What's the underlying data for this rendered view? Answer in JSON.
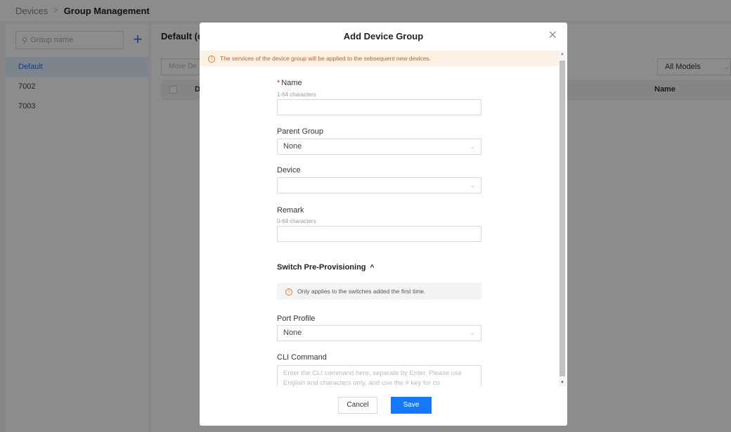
{
  "breadcrumb": {
    "parent": "Devices",
    "current": "Group Management"
  },
  "sidebar": {
    "search_placeholder": "Group name",
    "groups": [
      {
        "label": "Default",
        "active": true
      },
      {
        "label": "7002",
        "active": false
      },
      {
        "label": "7003",
        "active": false
      }
    ]
  },
  "main": {
    "title": "Default (d",
    "move_button": "Move De",
    "models_select": "All Models",
    "table_columns": {
      "checkbox": "",
      "first": "D",
      "name": "Name"
    }
  },
  "modal": {
    "title": "Add Device Group",
    "notice": "The services of the device group will be applied to the sebsequent new devices.",
    "fields": {
      "name": {
        "label": "Name",
        "required_mark": "*",
        "hint": "1-64 characters",
        "value": ""
      },
      "parent_group": {
        "label": "Parent Group",
        "value": "None"
      },
      "device": {
        "label": "Device",
        "value": ""
      },
      "remark": {
        "label": "Remark",
        "hint": "0-64 characters",
        "value": ""
      }
    },
    "section": {
      "title": "Switch Pre-Provisioning",
      "info": "Only applies to the switches added the first time."
    },
    "port_profile": {
      "label": "Port Profile",
      "value": "None"
    },
    "cli_command": {
      "label": "CLI Command",
      "placeholder": "Enter the CLI command here, separate by Enter. Please use English and characters only, and use the # key for co"
    },
    "buttons": {
      "cancel": "Cancel",
      "save": "Save"
    }
  },
  "colors": {
    "accent": "#1677ff",
    "notice_bg": "#fdf1e6",
    "notice_text": "#c0621a",
    "required": "#f5222d"
  },
  "icons": [
    "search-icon",
    "plus-icon",
    "close-icon",
    "warning-icon",
    "chevron-down-icon",
    "chevron-up-icon"
  ]
}
